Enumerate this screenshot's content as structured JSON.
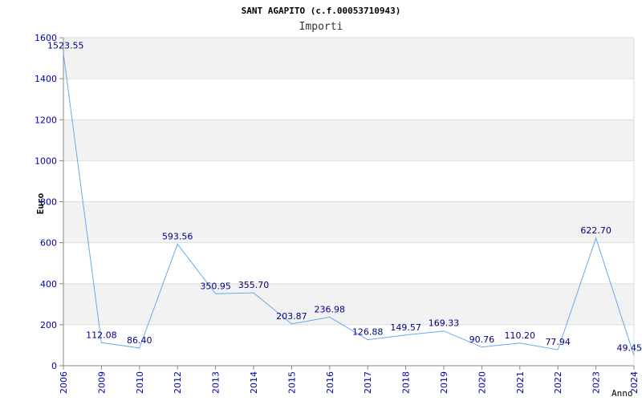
{
  "chart_data": {
    "type": "line",
    "title": "SANT AGAPITO (c.f.00053710943)",
    "subtitle": "Importi",
    "ylabel": "Euro",
    "xlabel": "Anno",
    "ylim": [
      0,
      1600
    ],
    "yticks": [
      "0",
      "200",
      "400",
      "600",
      "800",
      "1000",
      "1200",
      "1400",
      "1600"
    ],
    "grid": true,
    "series_color": "#66aaee",
    "band_color": "#f2f2f2",
    "tick_color": "#0000aa",
    "label_color": "#000080",
    "categories": [
      "2006",
      "2009",
      "2010",
      "2012",
      "2013",
      "2014",
      "2015",
      "2016",
      "2017",
      "2018",
      "2019",
      "2020",
      "2021",
      "2022",
      "2023",
      "2024"
    ],
    "values": [
      1523.55,
      112.08,
      86.4,
      593.56,
      350.95,
      355.7,
      203.87,
      236.98,
      126.88,
      149.57,
      169.33,
      90.76,
      110.2,
      77.94,
      622.7,
      49.45
    ],
    "value_labels": [
      "1523.55",
      "112.08",
      "86.40",
      "593.56",
      "350.95",
      "355.70",
      "203.87",
      "236.98",
      "126.88",
      "149.57",
      "169.33",
      "90.76",
      "110.20",
      "77.94",
      "622.70",
      "49.45"
    ]
  }
}
